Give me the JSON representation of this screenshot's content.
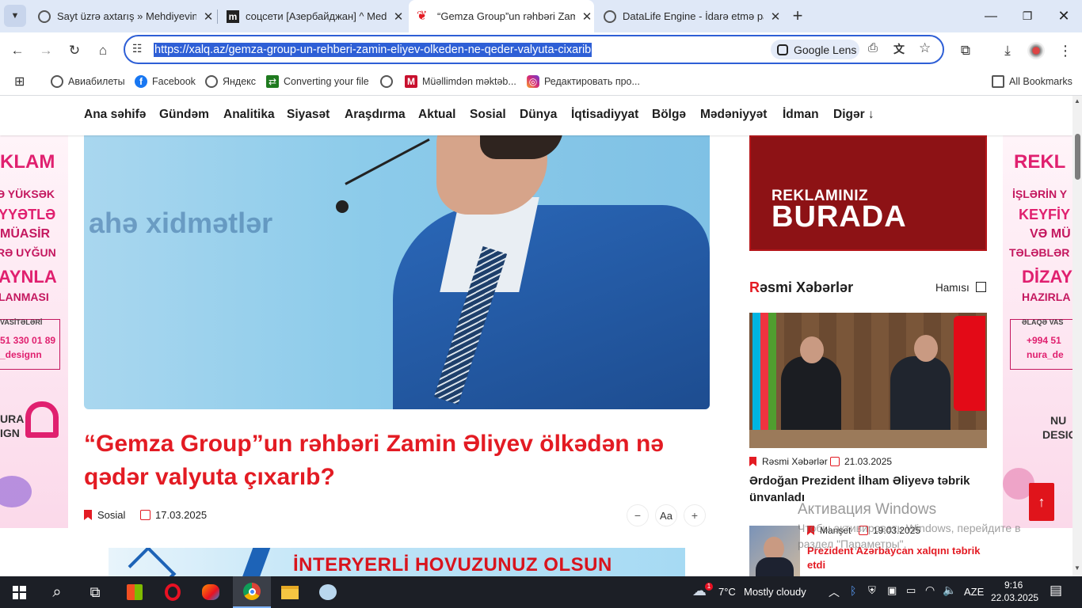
{
  "tabs": [
    {
      "title": "Sayt üzrə axtarış » Mehdiyevin İ",
      "icon": "globe"
    },
    {
      "title": "соцсети [Азербайджан] ^ Med",
      "icon": "m"
    },
    {
      "title": "“Gemza Group”un rəhbəri Zami",
      "icon": "xalq"
    },
    {
      "title": "DataLife Engine - İdarə etmə pa",
      "icon": "globe"
    }
  ],
  "new_tab_symbol": "+",
  "url": "https://xalq.az/gemza-group-un-rehberi-zamin-eliyev-olkeden-ne-qeder-valyuta-cixarib",
  "lens_label": "Google Lens",
  "bookmarks": [
    {
      "label": "Авиабилеты"
    },
    {
      "label": "Facebook"
    },
    {
      "label": "Яндекс"
    },
    {
      "label": "Converting your file"
    },
    {
      "label": ""
    },
    {
      "label": "Müəllimdən məktəb..."
    },
    {
      "label": "Редактировать про..."
    }
  ],
  "all_bookmarks": "All Bookmarks",
  "nav": [
    "Ana səhifə",
    "Gündəm",
    "Analitika",
    "Siyasət",
    "Araşdırma",
    "Aktual",
    "Sosial",
    "Dünya",
    "İqtisadiyyat",
    "Bölgə",
    "Mədəniyyət",
    "İdman",
    "Digər ↓"
  ],
  "left_ad": {
    "l1": "KLAM",
    "l2": "Ə YÜKSƏK",
    "l3": "YYƏTLƏ",
    "l4": "MÜASİR",
    "l5": "RƏ UYĞUN",
    "l6": "AYNLA",
    "l7": "LANMASI",
    "contacts": "VASİTƏLƏRİ",
    "phone": "51 330 01 89",
    "handle": "_designn",
    "brand1": "URA",
    "brand2": "IGN"
  },
  "right_ad": {
    "l1": "REKL",
    "l2": "İŞLƏRİN Y",
    "l3": "KEYFİY",
    "l4": "VƏ MÜ",
    "l5": "TƏLƏBLƏR",
    "l6": "DİZAY",
    "l7": "HAZIRLA",
    "contacts": "ƏLAQƏ VAS",
    "phone": "+994 51",
    "handle": "nura_de",
    "brand1": "NU",
    "brand2": "DESIG"
  },
  "hero_text": "ahə xidmətlər",
  "article": {
    "headline": "“Gemza Group”un rəhbəri Zamin Əliyev ölkədən nə qədər valyuta çıxarıb?",
    "category": "Sosial",
    "date": "17.03.2025",
    "font_label": "Aa",
    "minus": "−",
    "plus": "+"
  },
  "banner_text": "İNTERYERLİ HOVUZUNUZ OLSUN",
  "reklam": {
    "line1": "REKLAMINIZ",
    "line2": "BURADA"
  },
  "section": {
    "title_first": "R",
    "title_rest": "əsmi Xəbərlər",
    "all": "Hamısı"
  },
  "news": [
    {
      "category": "Rəsmi Xəbərlər",
      "date": "21.03.2025",
      "title": "Ərdoğan Prezident İlham Əliyevə təbrik ünvanladı"
    },
    {
      "category": "Manşet",
      "date": "19.03.2025",
      "title": "Prezident Azərbaycan xalqını təbrik etdi"
    }
  ],
  "watermark": {
    "title": "Активация Windows",
    "sub": "Чтобы активировать Windows, перейдите в раздел \"Параметры\"."
  },
  "taskbar": {
    "weather_temp": "7°C",
    "weather_text": "Mostly cloudy",
    "lang": "AZE",
    "time": "9:16",
    "date": "22.03.2025",
    "notif": "1"
  },
  "colors": {
    "brand_red": "#e31b23",
    "accent_blue": "#2e5fd6",
    "tab_bg": "#dfe8f7"
  }
}
